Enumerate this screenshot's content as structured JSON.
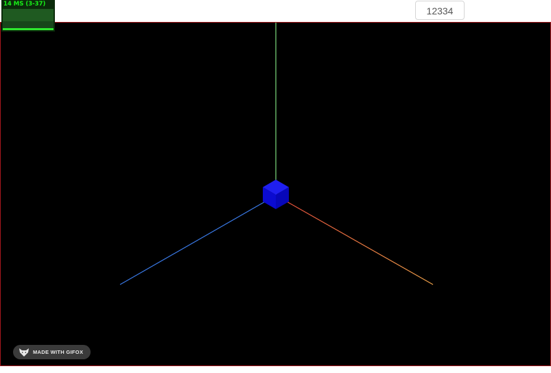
{
  "toolbar": {
    "counter_value": "12334"
  },
  "stats_panel": {
    "label": "14 MS (3-37)"
  },
  "scene": {
    "background_color": "#000000",
    "cube_color": "#0a0ad8",
    "axes": {
      "x_color": "#e8753a",
      "y_color": "#7ddc7d",
      "z_color": "#3a7ae8"
    }
  },
  "watermark": {
    "text": "MADE WITH GIFOX"
  }
}
